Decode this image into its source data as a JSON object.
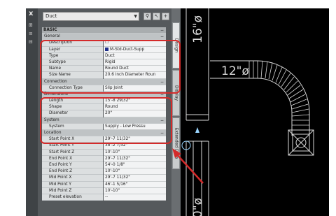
{
  "palette_strip": {
    "close_glyph": "x",
    "grip_glyphs": [
      "⊞",
      "≡",
      "⊟"
    ]
  },
  "panel": {
    "selector_value": "Duct",
    "toolbar_icons": [
      "quick-select-icon",
      "select-objects-icon",
      "toggle-pickadd-icon"
    ],
    "rows": [
      {
        "type": "cat",
        "key": "BASIC"
      },
      {
        "type": "sub",
        "key": "General"
      },
      {
        "key": "Description",
        "value": "☐"
      },
      {
        "key": "Layer",
        "value": "M-Std-Duct-Supp",
        "swatch": true
      },
      {
        "key": "Type",
        "value": "Duct"
      },
      {
        "key": "Subtype",
        "value": "Rigid"
      },
      {
        "key": "Name",
        "value": "Round Duct"
      },
      {
        "key": "Size Name",
        "value": "20.6 inch Diameter Roun"
      },
      {
        "type": "sub",
        "key": "Connection"
      },
      {
        "key": "Connection Type",
        "value": "Slip Joint"
      },
      {
        "type": "sub",
        "key": "Dimensions"
      },
      {
        "key": "Length",
        "value": "15'-8 29/32\""
      },
      {
        "key": "Shape",
        "value": "Round"
      },
      {
        "key": "Diameter",
        "value": "20\""
      },
      {
        "type": "sub",
        "key": "System"
      },
      {
        "key": "System",
        "value": "Supply - Low Pressu"
      },
      {
        "type": "sub",
        "key": "Location"
      },
      {
        "key": "Start Point X",
        "value": "29'-7 11/32\""
      },
      {
        "key": "Start Point Y",
        "value": "38'-2 7/32\""
      },
      {
        "key": "Start Point Z",
        "value": "10'-10\""
      },
      {
        "key": "End Point X",
        "value": "29'-7 11/32\""
      },
      {
        "key": "End Point Y",
        "value": "54'-0 1/8\""
      },
      {
        "key": "End Point Z",
        "value": "10'-10\""
      },
      {
        "key": "Mid Point X",
        "value": "29'-7 11/32\""
      },
      {
        "key": "Mid Point Y",
        "value": "46'-1 5/16\""
      },
      {
        "key": "Mid Point Z",
        "value": "10'-10\""
      },
      {
        "key": "Preset elevation",
        "value": "--"
      }
    ]
  },
  "side_tabs": [
    "Design",
    "Display",
    "Extended Data"
  ],
  "drawing": {
    "label_top": "16\"ø",
    "label_elbow": "12\"ø",
    "label_bottom": "0\"ø",
    "line_color": "#d9d9d9",
    "accent_color": "#9ad6ff"
  },
  "highlight_color": "#d42a2a"
}
